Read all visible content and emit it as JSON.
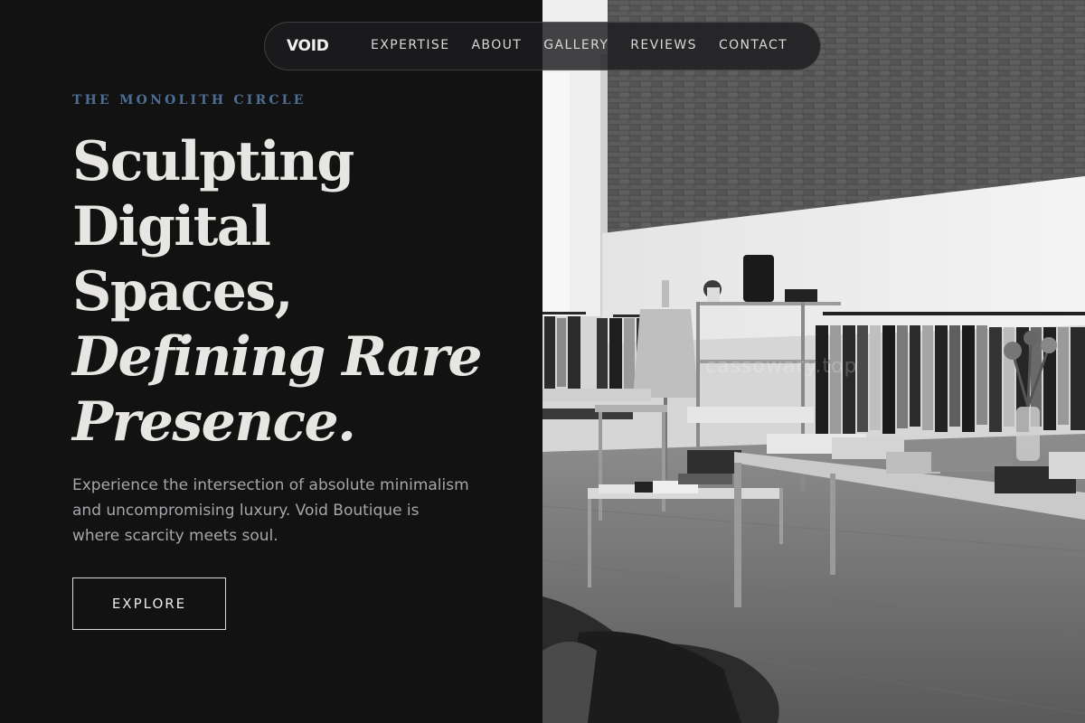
{
  "nav": {
    "brand": "VOID",
    "links": [
      "EXPERTISE",
      "ABOUT",
      "GALLERY",
      "REVIEWS",
      "CONTACT"
    ]
  },
  "hero": {
    "eyebrow": "THE MONOLITH CIRCLE",
    "headline_lines": [
      "Sculpting",
      "Digital",
      "Spaces,"
    ],
    "headline_italic_lines": [
      "Defining Rare",
      "Presence."
    ],
    "lead": "Experience the intersection of absolute minimalism and uncompromising luxury. Void Boutique is where scarcity meets soul.",
    "cta_label": "EXPLORE"
  },
  "photo": {
    "subject": "black-and-white boutique interior with clothing racks and display tables",
    "watermark": "cassowary.top"
  },
  "colors": {
    "background": "#121213",
    "eyebrow": "#4d6e93",
    "headline": "#e8e6e2",
    "body_text": "#a6a6ab",
    "nav_bg": "#1c1c1e"
  }
}
